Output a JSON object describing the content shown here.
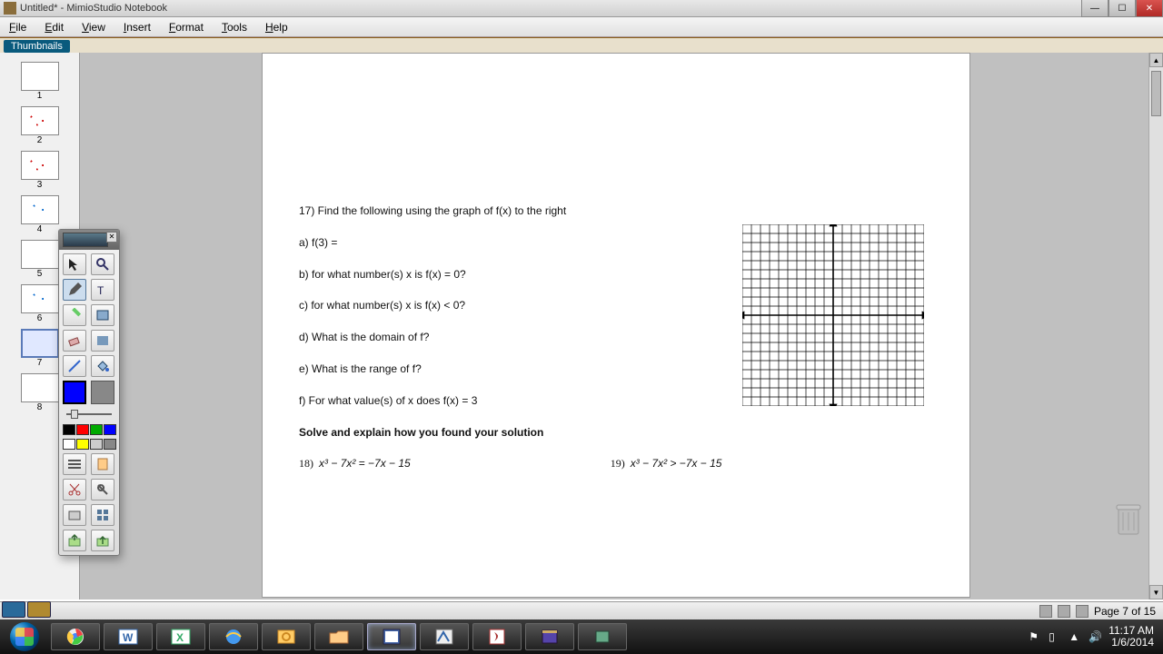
{
  "window": {
    "title": "Untitled* - MimioStudio Notebook"
  },
  "menu": [
    "File",
    "Edit",
    "View",
    "Insert",
    "Format",
    "Tools",
    "Help"
  ],
  "panel_label": "Thumbnails",
  "thumbs": [
    {
      "num": "1",
      "class": ""
    },
    {
      "num": "2",
      "class": "red-dots"
    },
    {
      "num": "3",
      "class": "red-dots"
    },
    {
      "num": "4",
      "class": "blue-dots"
    },
    {
      "num": "5",
      "class": ""
    },
    {
      "num": "6",
      "class": "blue-dots"
    },
    {
      "num": "7",
      "class": "",
      "selected": true
    },
    {
      "num": "8",
      "class": ""
    }
  ],
  "page": {
    "q17_intro": "17)  Find the following using the graph of f(x)  to the right",
    "q_a": "a)  f(3) =",
    "q_b": "b)  for what number(s) x is f(x) = 0?",
    "q_c": "c)  for what number(s) x is f(x) < 0?",
    "q_d": "d)  What is the domain of f?",
    "q_e": "e)  What is the range of f?",
    "q_f": "f)  For what value(s) of x does f(x) = 3",
    "solve_header": "Solve and explain how you found your solution",
    "q18_label": "18)",
    "q18_eq": "x³ − 7x² = −7x − 15",
    "q19_label": "19)",
    "q19_eq": "x³ − 7x² > −7x − 15"
  },
  "toolbox": {
    "colors_primary": "#0000ff",
    "palette_row1": [
      "#000000",
      "#ff0000",
      "#00aa00",
      "#0000ff"
    ],
    "palette_row2": [
      "#ffffff",
      "#ffff00",
      "#cccccc",
      "#888888"
    ]
  },
  "status": {
    "page": "Page 7 of 15"
  },
  "tray": {
    "time": "11:17 AM",
    "date": "1/6/2014"
  }
}
